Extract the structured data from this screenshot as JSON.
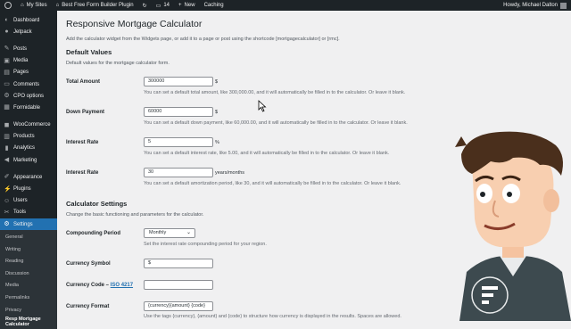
{
  "admin_bar": {
    "my_sites": "My Sites",
    "site_name": "Best Free Form Builder Plugin",
    "comments_count": "14",
    "new_label": "New",
    "caching_label": "Caching",
    "howdy": "Howdy, Michael Dalton"
  },
  "sidebar": {
    "items": [
      {
        "label": "Dashboard",
        "icon": "dashboard-icon"
      },
      {
        "label": "Jetpack",
        "icon": "jetpack-icon"
      },
      {
        "label": "Posts",
        "icon": "pin-icon"
      },
      {
        "label": "Media",
        "icon": "media-icon"
      },
      {
        "label": "Pages",
        "icon": "pages-icon"
      },
      {
        "label": "Comments",
        "icon": "comment-icon"
      },
      {
        "label": "CPO options",
        "icon": "gear-icon"
      },
      {
        "label": "Formidable",
        "icon": "formidable-icon"
      },
      {
        "label": "WooCommerce",
        "icon": "woo-icon"
      },
      {
        "label": "Products",
        "icon": "products-icon"
      },
      {
        "label": "Analytics",
        "icon": "chart-icon"
      },
      {
        "label": "Marketing",
        "icon": "megaphone-icon"
      },
      {
        "label": "Appearance",
        "icon": "brush-icon"
      },
      {
        "label": "Plugins",
        "icon": "plugin-icon"
      },
      {
        "label": "Users",
        "icon": "users-icon"
      },
      {
        "label": "Tools",
        "icon": "wrench-icon"
      },
      {
        "label": "Settings",
        "icon": "settings-icon"
      }
    ],
    "submenu": [
      "General",
      "Writing",
      "Reading",
      "Discussion",
      "Media",
      "Permalinks",
      "Privacy",
      "Resp Mortgage Calculator"
    ]
  },
  "page": {
    "title": "Responsive Mortgage Calculator",
    "intro": "Add the calculator widget from the Widgets page, or add it to a page or post using the shortcode [mortgagecalculator] or [rmc].",
    "default_values": {
      "heading": "Default Values",
      "description": "Default values for the mortgage calculator form.",
      "total_amount": {
        "label": "Total Amount",
        "value": "300000",
        "suffix": "$",
        "help": "You can set a default total amount, like 300,000.00, and it will automatically be filled in to the calculator. Or leave it blank."
      },
      "down_payment": {
        "label": "Down Payment",
        "value": "60000",
        "suffix": "$",
        "help": "You can set a default down payment, like 60,000.00, and it will automatically be filled in to the calculator. Or leave it blank."
      },
      "interest_rate": {
        "label": "Interest Rate",
        "value": "5",
        "suffix": "%",
        "help": "You can set a default interest rate, like 5.00, and it will automatically be filled in to the calculator. Or leave it blank."
      },
      "amortization": {
        "label": "Interest Rate",
        "value": "30",
        "suffix": "years/months",
        "help": "You can set a default amortization period, like 30, and it will automatically be filled in to the calculator. Or leave it blank."
      }
    },
    "calculator_settings": {
      "heading": "Calculator Settings",
      "description": "Change the basic functioning and parameters for the calculator.",
      "compounding": {
        "label": "Compounding Period",
        "value": "Monthly",
        "help": "Set the interest rate compounding period for your region."
      },
      "currency_symbol": {
        "label": "Currency Symbol",
        "value": "$"
      },
      "currency_code": {
        "label": "Currency Code –",
        "link": "ISO 4217",
        "value": ""
      },
      "currency_format": {
        "label": "Currency Format",
        "value": "{currency}{amount} {code}",
        "help": "Use the tags {currency}, {amount} and {code} to structure how currency is displayed in the results. Spaces are allowed."
      }
    }
  },
  "colors": {
    "sidebar_bg": "#1d2327",
    "accent": "#2271b1",
    "content_bg": "#f0f0f1"
  }
}
